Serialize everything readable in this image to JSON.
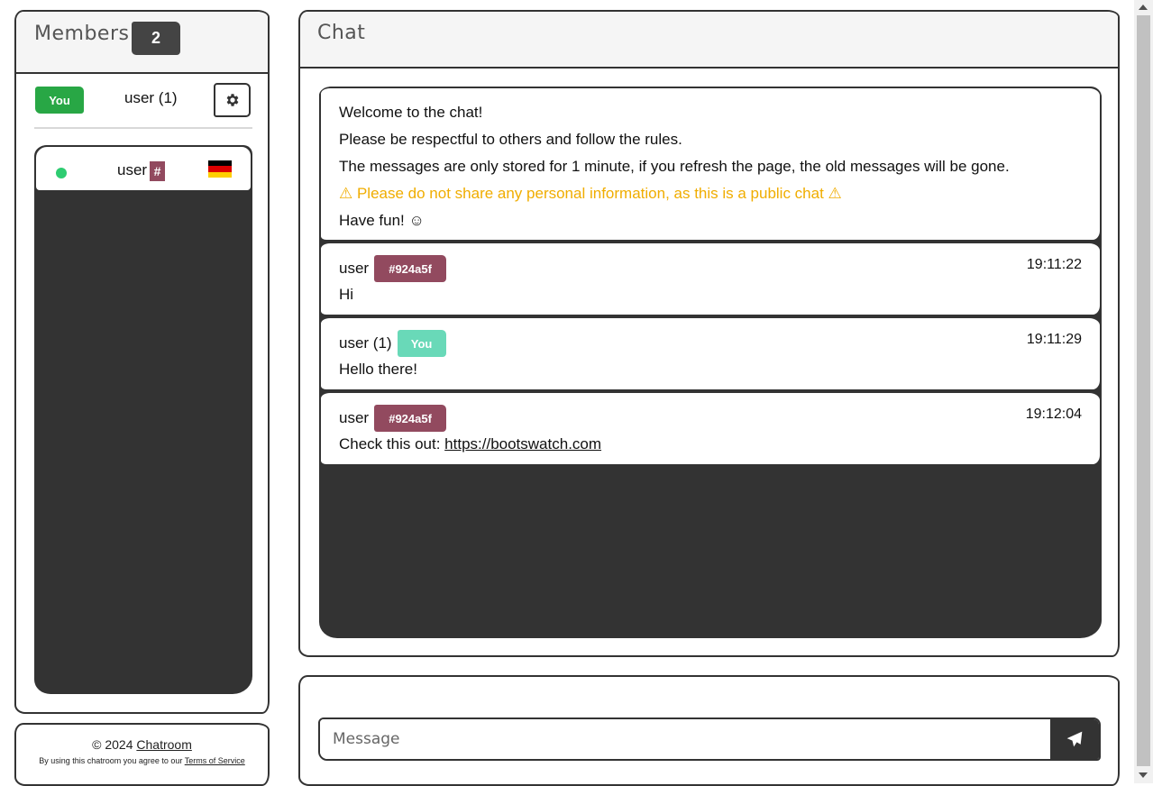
{
  "members": {
    "title": "Members",
    "count": "2",
    "self": {
      "badge": "You",
      "name": "user (1)"
    },
    "list": [
      {
        "name": "user",
        "tag": "#",
        "color": "#924a5f",
        "status": "online",
        "flag": "germany-flag"
      }
    ]
  },
  "footer": {
    "copyright_prefix": "© 2024 ",
    "brand_link": "Chatroom",
    "tos_prefix": "By using this chatroom you agree to our ",
    "tos_link": "Terms of Service"
  },
  "chat": {
    "title": "Chat",
    "welcome": {
      "line1": "Welcome to the chat!",
      "line2": "Please be respectful to others and follow the rules.",
      "line3": "The messages are only stored for 1 minute, if you refresh the page, the old messages will be gone.",
      "warning": "⚠ Please do not share any personal information, as this is a public chat ⚠",
      "line5": "Have fun! ☺"
    },
    "messages": [
      {
        "author": "user",
        "badge": "#924a5f",
        "badge_type": "hex",
        "time": "19:11:22",
        "text": "Hi",
        "link": ""
      },
      {
        "author": "user (1)",
        "badge": "You",
        "badge_type": "you",
        "time": "19:11:29",
        "text": "Hello there!",
        "link": ""
      },
      {
        "author": "user",
        "badge": "#924a5f",
        "badge_type": "hex",
        "time": "19:12:04",
        "text": "Check this out: ",
        "link": "https://bootswatch.com"
      }
    ]
  },
  "input": {
    "placeholder": "Message",
    "value": ""
  },
  "colors": {
    "accent_user": "#924a5f",
    "you_green": "#28a745",
    "you_teal": "#69d9b8",
    "warning": "#f0ad00",
    "dark": "#333333"
  },
  "icons": {
    "settings": "gear-icon",
    "send": "paper-plane-icon",
    "status": "online-dot-icon"
  }
}
